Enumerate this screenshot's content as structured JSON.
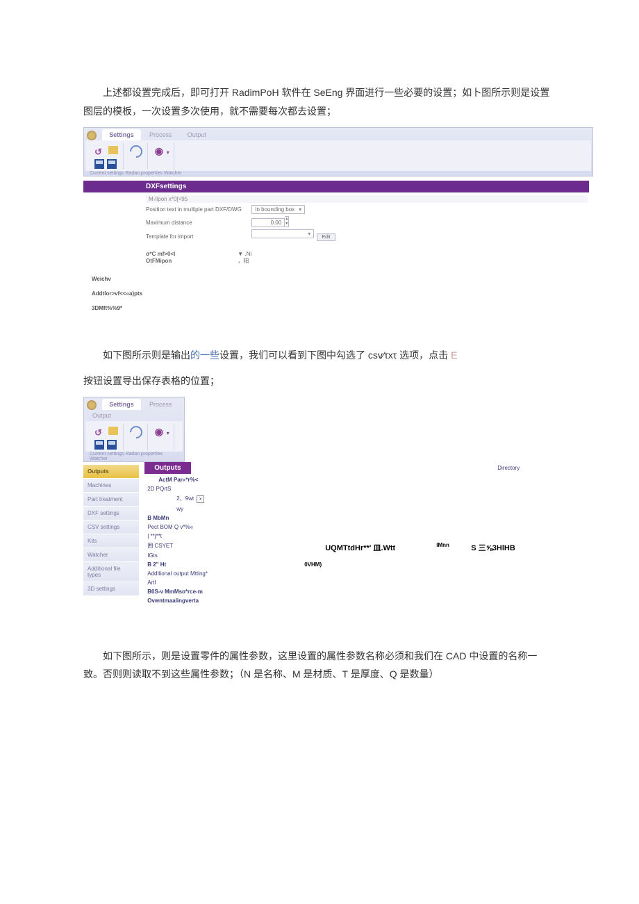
{
  "para1": "上述都设置完成后，即可打开 RadimPoH 软件在 SeEng 界面进行一些必要的设置；如卜图所示则是设置图层的模板，一次设置多次使用，就不需要每次都去设置；",
  "para2a": "如下图所示则是输出",
  "para2_link": "的一些",
  "para2b": "设置，我们可以看到下图中勾选了 csv⁄τxτ 选项，点击 ",
  "para2_e": "E",
  "para3": "按钮设置导出保存表格的位置；",
  "para4": "如下图所示，则是设置零件的属性参数，这里设置的属性参数名称必须和我们在 CAD 中设置的名称一致。否则则读取不到这些属性参数；（N 是名称、M 是材质、T 是厚度、Q 是数量）",
  "tabs": {
    "settings": "Settings",
    "process": "Process",
    "output": "Output"
  },
  "tlabels": "Current settings  Radan properties  Watcher",
  "s1": {
    "title": "DXFsettings",
    "header": "M√Ipon x*0[˅95",
    "r1": "Position text in multiple part DXF/DWG",
    "r1v": "In bounding box",
    "r2": "Maximum distance",
    "r2v": "0.00",
    "r3": "Template for import",
    "btn": "Edit",
    "ot1": "σ*C mf>0<I",
    "ot1r": "▼ .Ni",
    "ot2": "OtFMipon",
    "ot2r": "，阳",
    "ext1": "Weichv",
    "ext2": "Addtlor>vf<<«a)pts",
    "ext3": "3DMft%%9*"
  },
  "s2": {
    "menu": [
      "Outputs",
      "Machines",
      "Part treatment",
      "DXF settings",
      "CSV settings",
      "Kits",
      "Watcher",
      "Additional file types",
      "3D settings"
    ],
    "title": "Outputs",
    "a0": "ActM Par«*r%<",
    "a1": "2D PQrtS",
    "a1b": "2、9wt",
    "a1c": "wy",
    "a2": "B          MbMn",
    "a3": "Pect BOM Q        v*%«",
    "a4": "|  **j**t",
    "a5": "囲      CSYET",
    "a6": "IGts",
    "a6b": "B 2\" Ht",
    "a6r": "0VHM)",
    "a7": "Additional output Mtting*",
    "a7b": "ArtI",
    "a8": "B0S-v MmMso*rce-m",
    "a8b": "Ovwntmaalingverta",
    "dir": "Directory",
    "mid": "UQMTtdHr**' 皿.Wtt",
    "midr": "IMnn",
    "midr2": "S 三⅝3HlHB"
  }
}
